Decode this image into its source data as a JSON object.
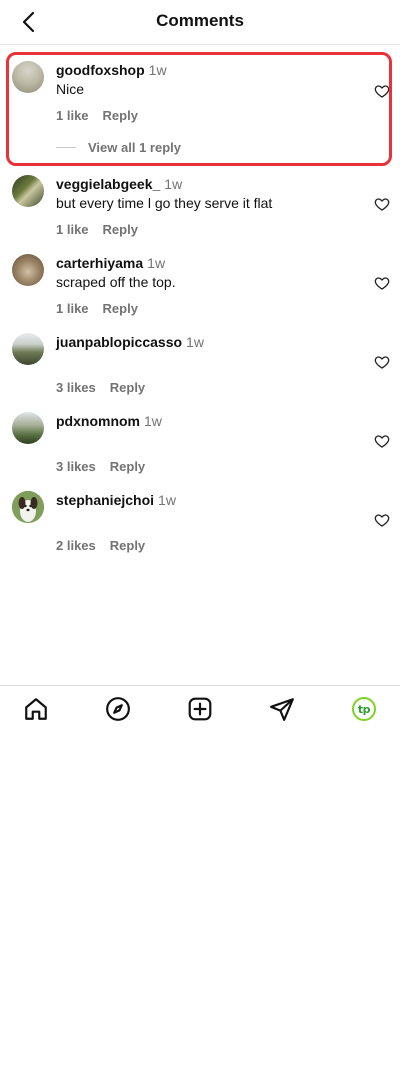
{
  "header": {
    "title": "Comments",
    "back_icon": "chevron-left-icon"
  },
  "comments": [
    {
      "username": "goodfoxshop",
      "time": "1w",
      "text": "Nice",
      "likes": "1 like",
      "reply": "Reply",
      "view_replies": "View all 1 reply",
      "avatar_color": "#b9b7a6"
    },
    {
      "username": "veggielabgeek_",
      "time": "1w",
      "text": "but every time l go they serve it flat",
      "likes": "1 like",
      "reply": "Reply",
      "avatar_color": "#4f5a3a"
    },
    {
      "username": "carterhiyama",
      "time": "1w",
      "text": "scraped off the top.",
      "likes": "1 like",
      "reply": "Reply",
      "avatar_color": "#8a7660"
    },
    {
      "username": "juanpablopiccasso",
      "time": "1w",
      "text": "",
      "likes": "3 likes",
      "reply": "Reply",
      "avatar_color": "#6e7a5a"
    },
    {
      "username": "pdxnomnom",
      "time": "1w",
      "text": "",
      "likes": "3 likes",
      "reply": "Reply",
      "avatar_color": "#5b7443"
    },
    {
      "username": "stephaniejchoi",
      "time": "1w",
      "text": "",
      "likes": "2 likes",
      "reply": "Reply",
      "avatar_color": "#6b8a4d"
    }
  ],
  "highlight_color": "#e8333b",
  "bottom_nav": [
    {
      "name": "home-icon"
    },
    {
      "name": "explore-compass-icon"
    },
    {
      "name": "new-post-icon"
    },
    {
      "name": "direct-send-icon"
    },
    {
      "name": "profile-avatar",
      "label": "tp"
    }
  ]
}
